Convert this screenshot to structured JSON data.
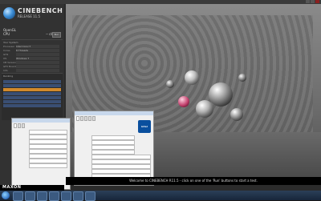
{
  "app": {
    "logo_title": "CINEBENCH",
    "logo_sub": "RELEASE 11.5"
  },
  "sidebar": {
    "result_label": "OpenGL",
    "result_row": {
      "k": "CPU",
      "v": "-- cb",
      "button": "Run"
    },
    "spec": {
      "title": "Your System",
      "rows": [
        {
          "k": "Processor",
          "v": "Intel Core i7"
        },
        {
          "k": "Cores",
          "v": "8 Threads"
        },
        {
          "k": "GHz",
          "v": ""
        },
        {
          "k": "OS",
          "v": "Windows 7"
        },
        {
          "k": "CB Version",
          "v": ""
        },
        {
          "k": "GFX Board",
          "v": ""
        },
        {
          "k": "Info",
          "v": ""
        }
      ]
    },
    "ranking": {
      "title": "Ranking",
      "rows": [
        {
          "t": "",
          "s": "",
          "highlight": false
        },
        {
          "t": "",
          "s": "",
          "highlight": false
        },
        {
          "t": "",
          "s": "",
          "highlight": true
        },
        {
          "t": "",
          "s": "",
          "highlight": false
        },
        {
          "t": "",
          "s": "",
          "highlight": false
        },
        {
          "t": "",
          "s": "",
          "highlight": false
        },
        {
          "t": "",
          "s": "",
          "highlight": false
        }
      ]
    }
  },
  "cpu_window": {
    "title": "",
    "tabs": [
      "",
      "",
      ""
    ],
    "fields": [
      {
        "k": "",
        "v": ""
      },
      {
        "k": "",
        "v": ""
      },
      {
        "k": "",
        "v": ""
      },
      {
        "k": "",
        "v": ""
      },
      {
        "k": "",
        "v": ""
      },
      {
        "k": "",
        "v": ""
      },
      {
        "k": "",
        "v": ""
      },
      {
        "k": "",
        "v": ""
      }
    ]
  },
  "cpuz_window": {
    "title": "",
    "tabs": [
      "",
      "",
      "",
      "",
      ""
    ],
    "badge": "intel",
    "fields": [
      {
        "k": "",
        "v": ""
      },
      {
        "k": "",
        "v": ""
      },
      {
        "k": "",
        "v": ""
      },
      {
        "k": "",
        "v": ""
      },
      {
        "k": "",
        "v": ""
      },
      {
        "k": "",
        "v": ""
      },
      {
        "k": "",
        "v": ""
      },
      {
        "k": "",
        "v": ""
      },
      {
        "k": "",
        "v": ""
      }
    ]
  },
  "status": {
    "text": "Welcome to CINEBENCH R11.5 - click on one of the 'Run' buttons to start a test."
  },
  "brand": {
    "maxon": "MAXON"
  },
  "taskbar": {
    "tray_time": "",
    "tray_date": ""
  }
}
